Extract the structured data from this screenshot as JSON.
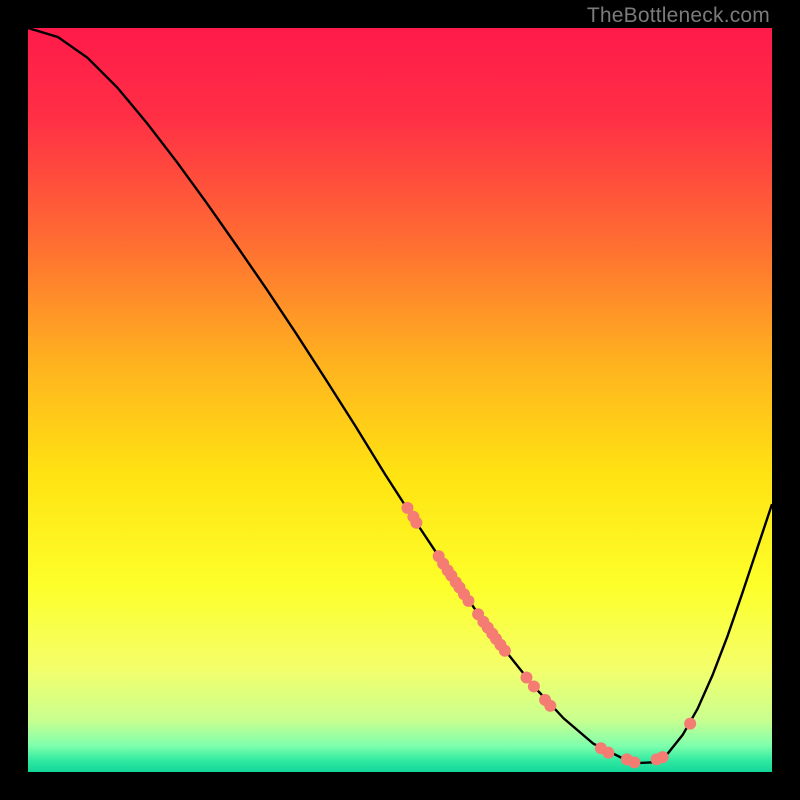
{
  "watermark": "TheBottleneck.com",
  "chart_data": {
    "type": "line",
    "title": "",
    "xlabel": "",
    "ylabel": "",
    "xlim": [
      0,
      100
    ],
    "ylim": [
      0,
      100
    ],
    "background_gradient": {
      "stops": [
        {
          "offset": 0.0,
          "color": "#ff1a4a"
        },
        {
          "offset": 0.12,
          "color": "#ff2f45"
        },
        {
          "offset": 0.28,
          "color": "#ff6a33"
        },
        {
          "offset": 0.45,
          "color": "#ffb21f"
        },
        {
          "offset": 0.6,
          "color": "#ffe312"
        },
        {
          "offset": 0.75,
          "color": "#fdff2a"
        },
        {
          "offset": 0.86,
          "color": "#f4ff6a"
        },
        {
          "offset": 0.93,
          "color": "#c9ff8f"
        },
        {
          "offset": 0.965,
          "color": "#7effad"
        },
        {
          "offset": 0.985,
          "color": "#2fe9a1"
        },
        {
          "offset": 1.0,
          "color": "#13d69a"
        }
      ]
    },
    "curve": [
      {
        "x": 0.0,
        "y": 100.0
      },
      {
        "x": 4.0,
        "y": 98.8
      },
      {
        "x": 8.0,
        "y": 96.0
      },
      {
        "x": 12.0,
        "y": 92.0
      },
      {
        "x": 16.0,
        "y": 87.2
      },
      {
        "x": 20.0,
        "y": 82.0
      },
      {
        "x": 24.0,
        "y": 76.5
      },
      {
        "x": 28.0,
        "y": 70.8
      },
      {
        "x": 32.0,
        "y": 65.0
      },
      {
        "x": 36.0,
        "y": 59.0
      },
      {
        "x": 40.0,
        "y": 52.8
      },
      {
        "x": 44.0,
        "y": 46.5
      },
      {
        "x": 48.0,
        "y": 40.0
      },
      {
        "x": 52.0,
        "y": 33.8
      },
      {
        "x": 56.0,
        "y": 27.8
      },
      {
        "x": 60.0,
        "y": 22.0
      },
      {
        "x": 64.0,
        "y": 16.5
      },
      {
        "x": 68.0,
        "y": 11.5
      },
      {
        "x": 72.0,
        "y": 7.2
      },
      {
        "x": 76.0,
        "y": 3.8
      },
      {
        "x": 80.0,
        "y": 1.8
      },
      {
        "x": 82.0,
        "y": 1.2
      },
      {
        "x": 84.0,
        "y": 1.3
      },
      {
        "x": 86.0,
        "y": 2.5
      },
      {
        "x": 88.0,
        "y": 5.0
      },
      {
        "x": 90.0,
        "y": 8.5
      },
      {
        "x": 92.0,
        "y": 13.0
      },
      {
        "x": 94.0,
        "y": 18.2
      },
      {
        "x": 96.0,
        "y": 24.0
      },
      {
        "x": 98.0,
        "y": 30.0
      },
      {
        "x": 100.0,
        "y": 36.0
      }
    ],
    "markers": [
      {
        "x": 51.0,
        "y": 35.5,
        "r": 6
      },
      {
        "x": 51.8,
        "y": 34.3,
        "r": 6
      },
      {
        "x": 52.2,
        "y": 33.5,
        "r": 6
      },
      {
        "x": 55.2,
        "y": 29.0,
        "r": 6
      },
      {
        "x": 55.8,
        "y": 28.0,
        "r": 6
      },
      {
        "x": 56.4,
        "y": 27.1,
        "r": 6
      },
      {
        "x": 56.9,
        "y": 26.4,
        "r": 6
      },
      {
        "x": 57.5,
        "y": 25.5,
        "r": 6
      },
      {
        "x": 58.0,
        "y": 24.8,
        "r": 6
      },
      {
        "x": 58.6,
        "y": 23.9,
        "r": 6
      },
      {
        "x": 59.2,
        "y": 23.0,
        "r": 6
      },
      {
        "x": 60.5,
        "y": 21.2,
        "r": 6
      },
      {
        "x": 61.2,
        "y": 20.2,
        "r": 6
      },
      {
        "x": 61.8,
        "y": 19.4,
        "r": 6
      },
      {
        "x": 62.4,
        "y": 18.6,
        "r": 6
      },
      {
        "x": 62.9,
        "y": 17.9,
        "r": 6
      },
      {
        "x": 63.5,
        "y": 17.1,
        "r": 6
      },
      {
        "x": 64.1,
        "y": 16.3,
        "r": 6
      },
      {
        "x": 67.0,
        "y": 12.7,
        "r": 6
      },
      {
        "x": 68.0,
        "y": 11.5,
        "r": 6
      },
      {
        "x": 69.5,
        "y": 9.7,
        "r": 6
      },
      {
        "x": 70.2,
        "y": 8.9,
        "r": 6
      },
      {
        "x": 77.0,
        "y": 3.2,
        "r": 6
      },
      {
        "x": 78.0,
        "y": 2.6,
        "r": 6
      },
      {
        "x": 80.5,
        "y": 1.7,
        "r": 6
      },
      {
        "x": 81.5,
        "y": 1.3,
        "r": 6
      },
      {
        "x": 84.5,
        "y": 1.7,
        "r": 6
      },
      {
        "x": 85.3,
        "y": 2.0,
        "r": 6
      },
      {
        "x": 89.0,
        "y": 6.5,
        "r": 6
      }
    ],
    "marker_color": "#f47c73",
    "curve_color": "#000000"
  }
}
